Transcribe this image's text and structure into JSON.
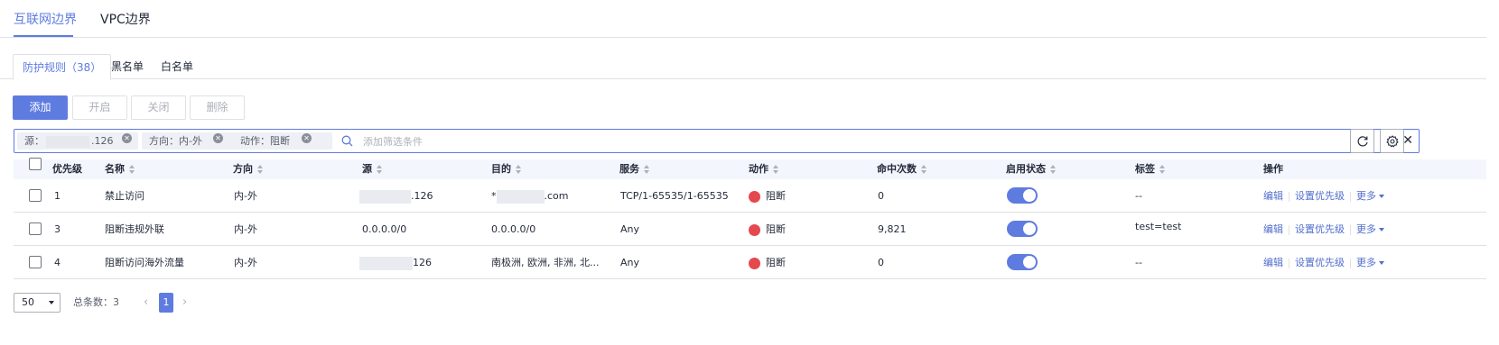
{
  "top_tabs": [
    {
      "label": "互联网边界",
      "active": true
    },
    {
      "label": "VPC边界",
      "active": false
    }
  ],
  "sub_tabs": [
    {
      "label": "防护规则（38）",
      "active": true
    },
    {
      "label": "黑名单",
      "active": false
    },
    {
      "label": "白名单",
      "active": false
    }
  ],
  "toolbar": {
    "add_label": "添加",
    "enable_label": "开启",
    "disable_label": "关闭",
    "delete_label": "删除"
  },
  "filter": {
    "chips": [
      {
        "prefix": "源：",
        "suffix": ".126"
      },
      {
        "prefix": "方向：内-外",
        "suffix": ""
      },
      {
        "prefix": "动作：阻断",
        "suffix": ""
      }
    ],
    "placeholder": "添加筛选条件",
    "clear_icon": "close-icon"
  },
  "icons": {
    "refresh": "refresh-icon",
    "settings": "gear-icon",
    "search": "search-icon"
  },
  "table": {
    "columns": [
      "优先级",
      "名称",
      "方向",
      "源",
      "目的",
      "服务",
      "动作",
      "命中次数",
      "启用状态",
      "标签",
      "操作"
    ],
    "rows": [
      {
        "priority": "1",
        "name": "禁止访问",
        "direction": "内-外",
        "source": ".126",
        "source_masked": true,
        "dest_prefix": "*",
        "dest_suffix": ".com",
        "dest_masked": true,
        "service": "TCP/1-65535/1-65535",
        "action": "阻断",
        "hits": "0",
        "enabled": true,
        "tag": "--"
      },
      {
        "priority": "3",
        "name": "阻断违规外联",
        "direction": "内-外",
        "source": "0.0.0.0/0",
        "source_masked": false,
        "dest_prefix": "0.0.0.0/0",
        "dest_suffix": "",
        "dest_masked": false,
        "service": "Any",
        "action": "阻断",
        "hits": "9,821",
        "enabled": true,
        "tag": "test=test"
      },
      {
        "priority": "4",
        "name": "阻断访问海外流量",
        "direction": "内-外",
        "source": "126",
        "source_masked": true,
        "dest_prefix": "南极洲, 欧洲, 非洲, 北...",
        "dest_suffix": "",
        "dest_masked": false,
        "service": "Any",
        "action": "阻断",
        "hits": "0",
        "enabled": true,
        "tag": "--"
      }
    ],
    "ops": {
      "edit": "编辑",
      "set_priority": "设置优先级",
      "more": "更多"
    }
  },
  "pager": {
    "page_size": "50",
    "total_label": "总条数：3",
    "current_page": "1"
  },
  "colors": {
    "accent": "#5e7ce0",
    "link": "#526ecc",
    "block_red": "#e5484d"
  }
}
